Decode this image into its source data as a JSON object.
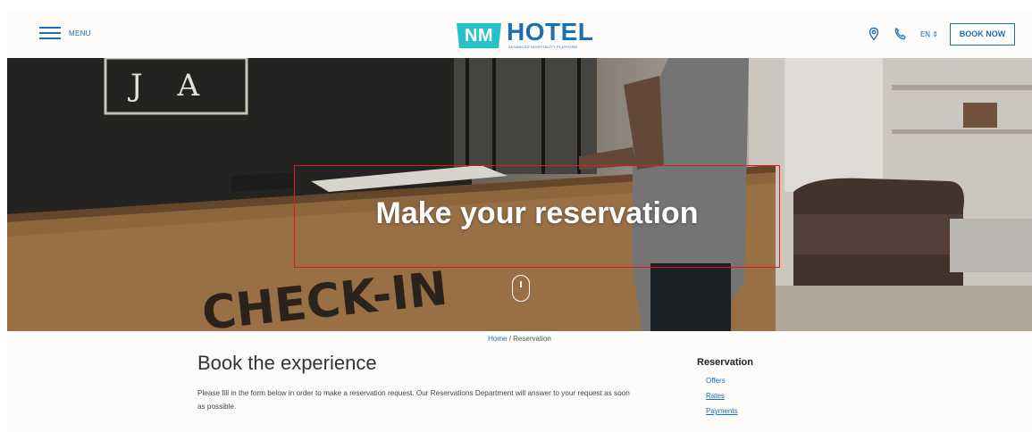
{
  "header": {
    "menu_label": "MENU",
    "logo": {
      "badge": "NM",
      "name": "HOTEL",
      "tagline": "ADVANCED HOSPITALITY PLATFORM"
    },
    "language": "EN",
    "book_now": "BOOK NOW",
    "icons": [
      "map-pin-icon",
      "phone-icon"
    ]
  },
  "hero": {
    "title": "Make your reservation",
    "desk_sign": "CHECK-IN",
    "wall_letters": "J A"
  },
  "breadcrumb": {
    "home": "Home",
    "separator": " / ",
    "current": "Reservation"
  },
  "main": {
    "title": "Book the experience",
    "description": "Please fill in the form below in order to make a reservation request. Our Reservations Department will answer to your request as soon as possible."
  },
  "sidebar": {
    "title": "Reservation",
    "links": [
      "Offers",
      "Rates",
      "Payments"
    ]
  },
  "colors": {
    "brand_blue": "#1c6fb5",
    "brand_teal": "#27c3c6",
    "highlight_red": "#e0191c"
  }
}
